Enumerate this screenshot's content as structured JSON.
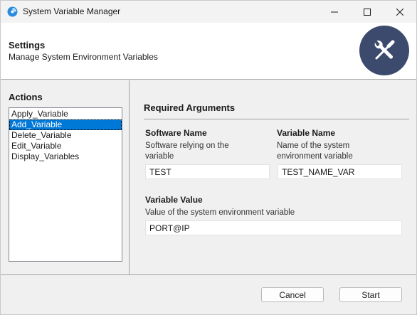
{
  "window": {
    "title": "System Variable Manager",
    "icons": [
      "app-icon",
      "minimize-icon",
      "maximize-icon",
      "close-icon"
    ]
  },
  "header": {
    "title": "Settings",
    "subtitle": "Manage System Environment Variables",
    "icon": "tools-icon",
    "icon_bg_color": "#3c4b6d"
  },
  "actions": {
    "title": "Actions",
    "items": [
      {
        "label": "Apply_Variable"
      },
      {
        "label": "Add_Variable",
        "selected": true
      },
      {
        "label": "Delete_Variable"
      },
      {
        "label": "Edit_Variable"
      },
      {
        "label": "Display_Variables"
      }
    ],
    "selection_color": "#0078d7"
  },
  "required": {
    "title": "Required Arguments",
    "software_name": {
      "label": "Software Name",
      "description": "Software relying on the variable",
      "value": "TEST"
    },
    "variable_name": {
      "label": "Variable Name",
      "description": "Name of the system environment variable",
      "value": "TEST_NAME_VAR"
    },
    "variable_value": {
      "label": "Variable Value",
      "description": "Value of the system environment variable",
      "value": "PORT@IP"
    }
  },
  "footer": {
    "cancel_label": "Cancel",
    "start_label": "Start"
  }
}
